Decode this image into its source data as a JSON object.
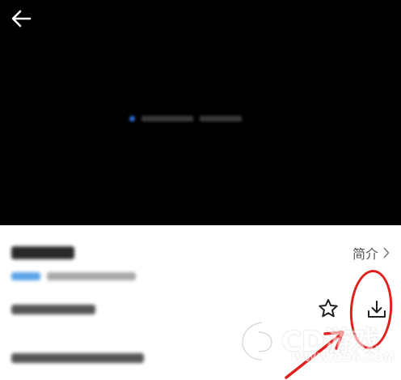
{
  "info": {
    "intro_label": "简介"
  },
  "icons": {
    "back": "arrow-left-icon",
    "intro_chevron": "chevron-right-icon",
    "favorite": "star-icon",
    "download": "download-icon"
  },
  "watermark": {
    "brand": "CD游戏",
    "url": "WWW.CD6.COM"
  },
  "colors": {
    "player_bg": "#000000",
    "annotation": "#e0201c",
    "tag_accent": "#5aa3e8"
  }
}
